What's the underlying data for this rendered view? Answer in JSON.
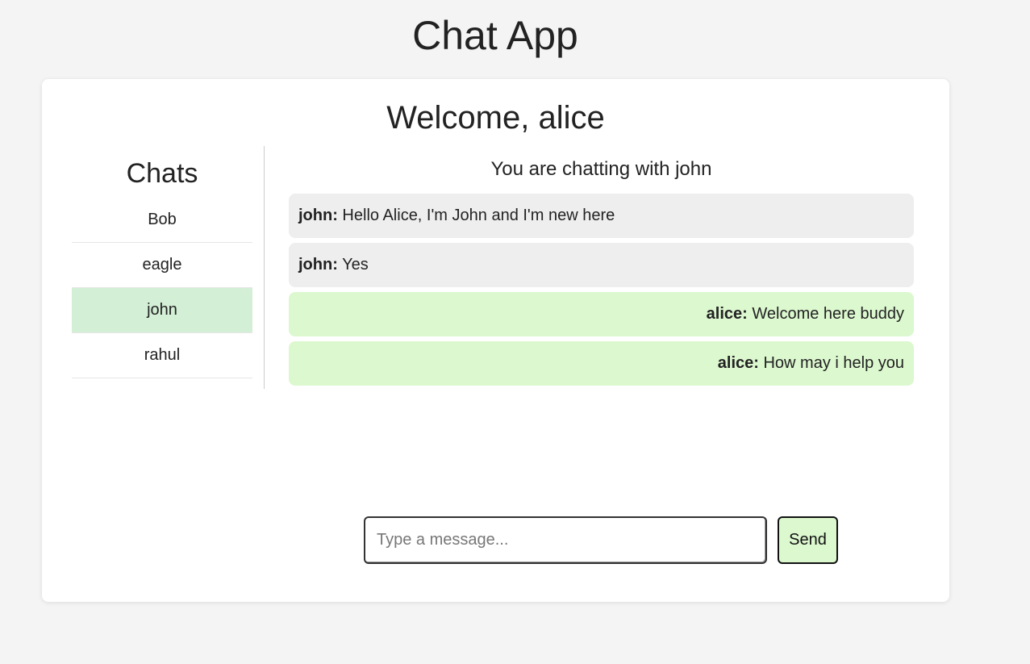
{
  "app": {
    "title": "Chat App"
  },
  "header": {
    "welcome": "Welcome, alice"
  },
  "sidebar": {
    "heading": "Chats",
    "items": [
      {
        "label": "Bob",
        "active": false
      },
      {
        "label": "eagle",
        "active": false
      },
      {
        "label": "john",
        "active": true
      },
      {
        "label": "rahul",
        "active": false
      }
    ]
  },
  "chat": {
    "status": "You are chatting with john",
    "messages": [
      {
        "sender": "john:",
        "text": " Hello Alice, I'm John and I'm new here",
        "direction": "incoming"
      },
      {
        "sender": "john:",
        "text": " Yes",
        "direction": "incoming"
      },
      {
        "sender": "alice:",
        "text": " Welcome here buddy",
        "direction": "outgoing"
      },
      {
        "sender": "alice:",
        "text": " How may i help you",
        "direction": "outgoing"
      }
    ]
  },
  "composer": {
    "value": "",
    "placeholder": "Type a message...",
    "send_label": "Send"
  },
  "colors": {
    "page_background": "#f4f4f4",
    "active_chat": "#d3efd5",
    "incoming_bubble": "#eeeeee",
    "outgoing_bubble": "#dcf8cf",
    "send_button": "#dcf8cf"
  }
}
